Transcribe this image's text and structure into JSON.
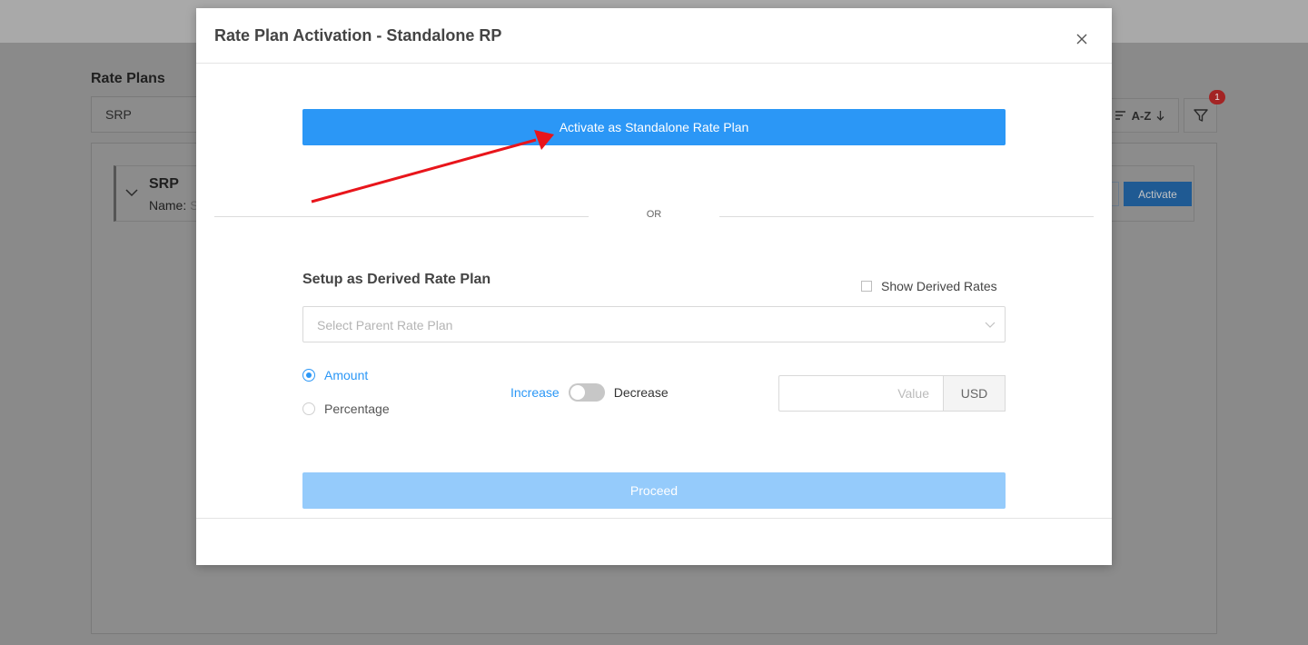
{
  "background": {
    "section_title": "Rate Plans",
    "search_value": "SRP",
    "sort_label": "A-Z",
    "filter_badge": "1",
    "card": {
      "title": "SRP",
      "name_label": "Name:",
      "name_value": "S",
      "activate_label": "Activate"
    }
  },
  "modal": {
    "title": "Rate Plan Activation - Standalone RP",
    "standalone_button": "Activate as Standalone Rate Plan",
    "or_text": "OR",
    "derived_title": "Setup as Derived Rate Plan",
    "show_derived_label": "Show Derived Rates",
    "show_derived_checked": false,
    "parent_placeholder": "Select Parent Rate Plan",
    "adjustment_types": [
      {
        "label": "Amount",
        "selected": true
      },
      {
        "label": "Percentage",
        "selected": false
      }
    ],
    "increase_label": "Increase",
    "decrease_label": "Decrease",
    "value_placeholder": "Value",
    "currency": "USD",
    "proceed_label": "Proceed"
  },
  "colors": {
    "primary": "#2b97f6",
    "primary_disabled": "#95cbfb",
    "annotation_arrow": "#e8151b",
    "overlay": "#8a8a8a"
  }
}
